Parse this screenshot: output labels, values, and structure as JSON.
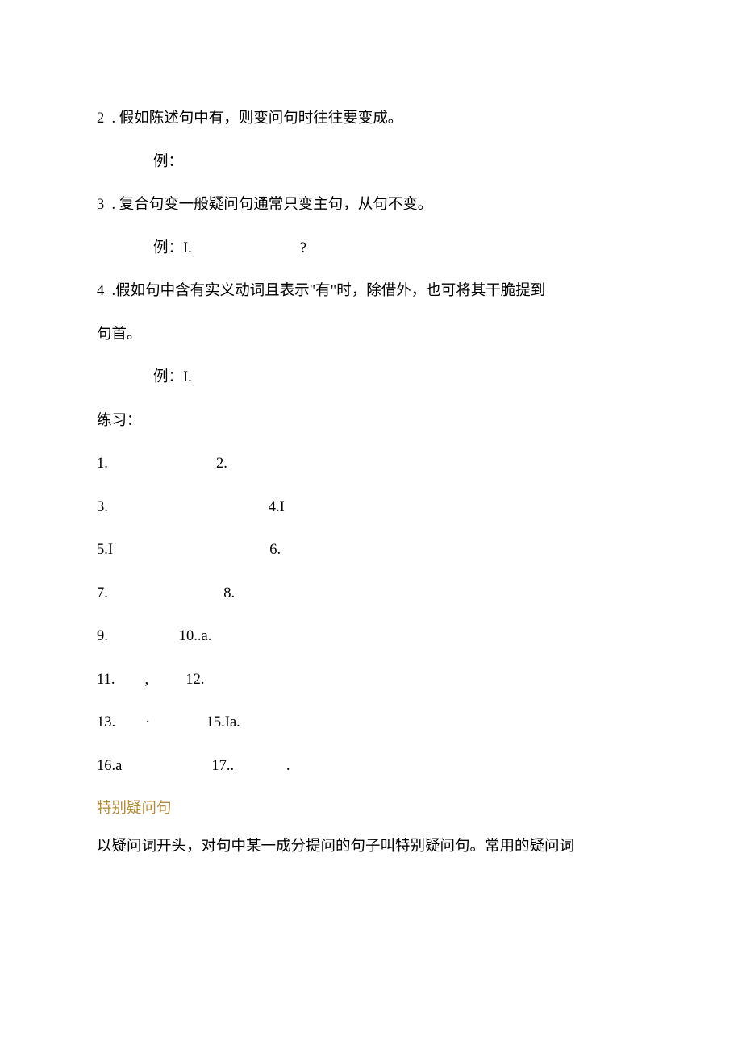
{
  "lines": {
    "l2": "2  . 假如陈述句中有，则变问句时往往要变成。",
    "l2_ex": "例：",
    "l3": "3  . 复合句变一般疑问句通常只变主句，从句不变。",
    "l3_ex": "例：I.                             ?",
    "l4": "4  .假如句中含有实义动词且表示\"有\"时，除借外，也可将其干脆提到",
    "l4b": "句首。",
    "l4_ex": "例：I.",
    "practice": "练习：",
    "r1": "1.                             2.",
    "r2": "3.                                           4.I",
    "r3": "5.I                                          6.",
    "r4": "7.                               8.",
    "r5": "9.                   10..a.",
    "r6": "11.        ,          12.",
    "r7": "13.        ·               15.Ia.",
    "r8": "16.a                        17..              .",
    "heading": "特别疑问句",
    "final": "以疑问词开头，对句中某一成分提问的句子叫特别疑问句。常用的疑问词"
  }
}
